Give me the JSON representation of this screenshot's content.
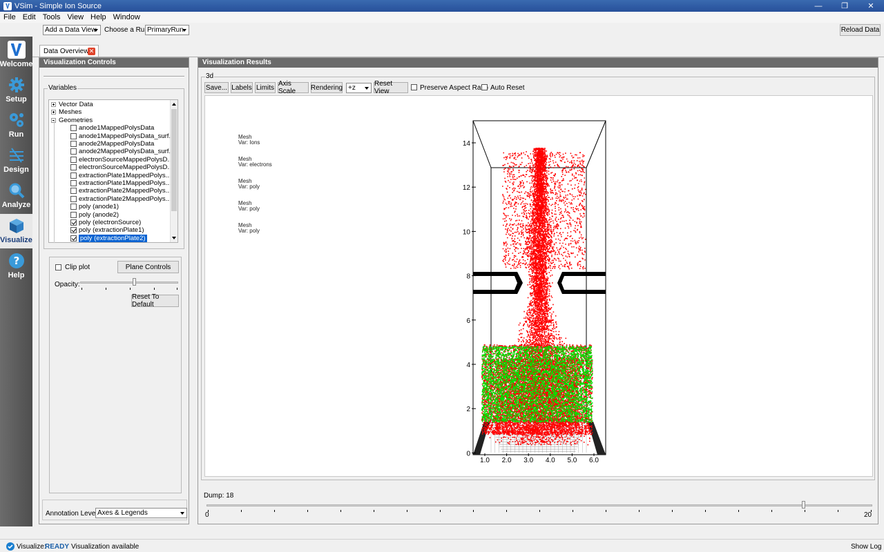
{
  "window": {
    "title": "VSim - Simple Ion Source"
  },
  "menu": [
    "File",
    "Edit",
    "Tools",
    "View",
    "Help",
    "Window"
  ],
  "toolbar": {
    "add_data_view": "Add a Data View",
    "choose_run_label": "Choose a Run:",
    "run_value": "PrimaryRun",
    "reload": "Reload Data"
  },
  "left_tools": [
    {
      "label": "Welcome",
      "icon": "vsim-logo-icon"
    },
    {
      "label": "Setup",
      "icon": "gear-icon"
    },
    {
      "label": "Run",
      "icon": "gears-icon"
    },
    {
      "label": "Design",
      "icon": "design-icon"
    },
    {
      "label": "Analyze",
      "icon": "magnifier-icon"
    },
    {
      "label": "Visualize",
      "icon": "cube-icon"
    },
    {
      "label": "Help",
      "icon": "help-icon"
    }
  ],
  "tab": {
    "label": "Data Overview"
  },
  "controls": {
    "header": "Visualization Controls",
    "variables_title": "Variables",
    "tree": [
      {
        "label": "Vector Data",
        "type": "group"
      },
      {
        "label": "Meshes",
        "type": "group"
      },
      {
        "label": "Geometries",
        "type": "group-open"
      },
      {
        "label": "anode1MappedPolysData",
        "checked": false
      },
      {
        "label": "anode1MappedPolysData_surf...",
        "checked": false
      },
      {
        "label": "anode2MappedPolysData",
        "checked": false
      },
      {
        "label": "anode2MappedPolysData_surf...",
        "checked": false
      },
      {
        "label": "electronSourceMappedPolysD...",
        "checked": false
      },
      {
        "label": "electronSourceMappedPolysD...",
        "checked": false
      },
      {
        "label": "extractionPlate1MappedPolys...",
        "checked": false
      },
      {
        "label": "extractionPlate1MappedPolys...",
        "checked": false
      },
      {
        "label": "extractionPlate2MappedPolys...",
        "checked": false
      },
      {
        "label": "extractionPlate2MappedPolys...",
        "checked": false
      },
      {
        "label": "poly (anode1)",
        "checked": false
      },
      {
        "label": "poly (anode2)",
        "checked": false
      },
      {
        "label": "poly (electronSource)",
        "checked": true
      },
      {
        "label": "poly (extractionPlate1)",
        "checked": true
      },
      {
        "label": "poly (extractionPlate2)",
        "checked": true,
        "selected": true
      }
    ],
    "clip_plot": "Clip plot",
    "plane_controls": "Plane Controls",
    "opacity": "Opacity:",
    "opacity_value": 0.55,
    "reset_default": "Reset To Default",
    "annotation_label": "Annotation Level:",
    "annotation_value": "Axes & Legends"
  },
  "results": {
    "header": "Visualization Results",
    "group": "3d",
    "buttons": [
      "Save...",
      "Labels",
      "Limits",
      "Axis Scale",
      "Rendering"
    ],
    "view_dir": "+z",
    "reset_view": "Reset View",
    "preserve_aspect": "Preserve Aspect Ratio",
    "auto_reset": "Auto Reset",
    "legends": [
      {
        "mesh": "Mesh",
        "var": "Var: Ions"
      },
      {
        "mesh": "Mesh",
        "var": "Var: electrons"
      },
      {
        "mesh": "Mesh",
        "var": "Var: poly"
      },
      {
        "mesh": "Mesh",
        "var": "Var: poly"
      },
      {
        "mesh": "Mesh",
        "var": "Var: poly"
      }
    ],
    "plot": {
      "y_ticks": [
        "14",
        "12",
        "10",
        "8",
        "6",
        "4",
        "2",
        "0"
      ],
      "x_ticks": [
        "1.0",
        "2.0",
        "3.0",
        "4.0",
        "5.0",
        "6.0"
      ],
      "ion_color": "#ff0000",
      "electron_color": "#00e000"
    }
  },
  "dump": {
    "label": "Dump: 18",
    "min": "0",
    "max": "20",
    "value": 18
  },
  "status": {
    "mode": "Visualize:",
    "state": "READY",
    "message": "Visualization available",
    "show_log": "Show Log"
  }
}
